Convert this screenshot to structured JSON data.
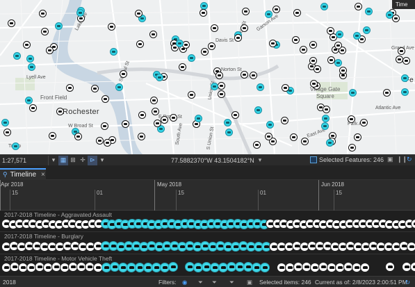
{
  "map": {
    "time_button": "Time",
    "labels": {
      "city": "Rochester",
      "village_gate": "Village Gate",
      "village_gate2": "Square",
      "front_field": "Front Field",
      "w_broad": "W Broad St",
      "e_broad": "E Broad St",
      "davis": "Davis St",
      "scio": "Scio St",
      "union_n": "Union St",
      "union_s": "S Union St",
      "grand": "Grand Ave",
      "atlantic": "Atlantic Ave",
      "east_ave": "East Ave",
      "st_paul": "St Paul St",
      "monroe": "Monroe Ave",
      "lyell": "Lyell Ave",
      "troup": "Troup",
      "lake": "Lake Ave",
      "norton": "Norton St",
      "s_ave": "South Ave",
      "garson": "Garson Ave",
      "park": "Park Ave",
      "fe": "Fe",
      "upper_el": "Ce"
    }
  },
  "status_bar": {
    "scale": "1:27,571",
    "coords": "77.5882370°W 43.1504182°N",
    "selected_features": "Selected Features: 246"
  },
  "timeline_tab": {
    "label": "Timeline"
  },
  "ruler": {
    "months": [
      "Apr 2018",
      "May 2018",
      "Jun 2018"
    ],
    "days": [
      "15",
      "01",
      "15",
      "01",
      "15"
    ]
  },
  "tracks": [
    {
      "name": "2017-2018 Timeline - Aggravated Assault"
    },
    {
      "name": "2017-2018 Timeline - Burglary"
    },
    {
      "name": "2017-2018 Timeline - Motor Vehicle Theft"
    }
  ],
  "bottom_bar": {
    "year": "2018",
    "filters": "Filters:",
    "selected_items": "Selected items: 246",
    "current_as_of": "Current as of: 2/8/2023 2:00:51 PM"
  }
}
